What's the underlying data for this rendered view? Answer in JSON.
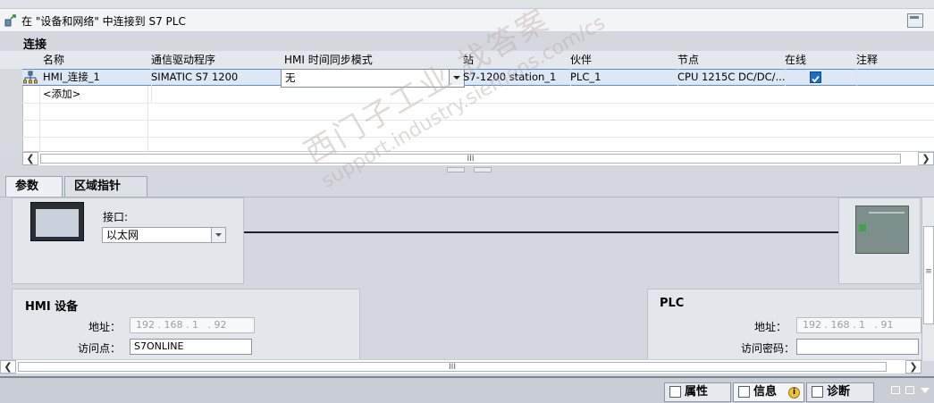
{
  "window": {
    "title": "在 \"设备和网络\" 中连接到 S7 PLC",
    "section_label": "连接"
  },
  "table": {
    "columns": [
      "名称",
      "通信驱动程序",
      "HMI 时间同步模式",
      "站",
      "伙伴",
      "节点",
      "在线",
      "注释"
    ],
    "rows": [
      {
        "name": "HMI_连接_1",
        "driver": "SIMATIC S7 1200",
        "sync_mode": "无",
        "station": "S7-1200 station_1",
        "partner": "PLC_1",
        "node": "CPU 1215C DC/DC/...",
        "online": true,
        "comment": ""
      }
    ],
    "add_row_label": "<添加>",
    "scrollbar_grip": "III"
  },
  "tabs": {
    "params": "参数",
    "area_pointer": "区域指针"
  },
  "params": {
    "interface_label": "接口:",
    "interface_value": "以太网",
    "hmi_device_title": "HMI 设备",
    "hmi_address_label": "地址：",
    "hmi_address_value": "192 . 168 . 1   . 92",
    "access_point_label": "访问点：",
    "access_point_value": "S7ONLINE",
    "plc_title": "PLC",
    "plc_address_label": "地址：",
    "plc_address_value": "192 . 168 . 1   . 91",
    "access_password_label": "访问密码：",
    "access_password_value": ""
  },
  "statusbar": {
    "properties": "属性",
    "info": "信息",
    "diagnostics": "诊断"
  },
  "watermark": {
    "line1": "西门子工业 找答案",
    "line2": "support.industry.siemens.com/cs"
  },
  "colors": {
    "selected_row": "#dde8f7",
    "selected_border": "#5b8bd0",
    "checkbox_blue": "#1d6fc4"
  }
}
